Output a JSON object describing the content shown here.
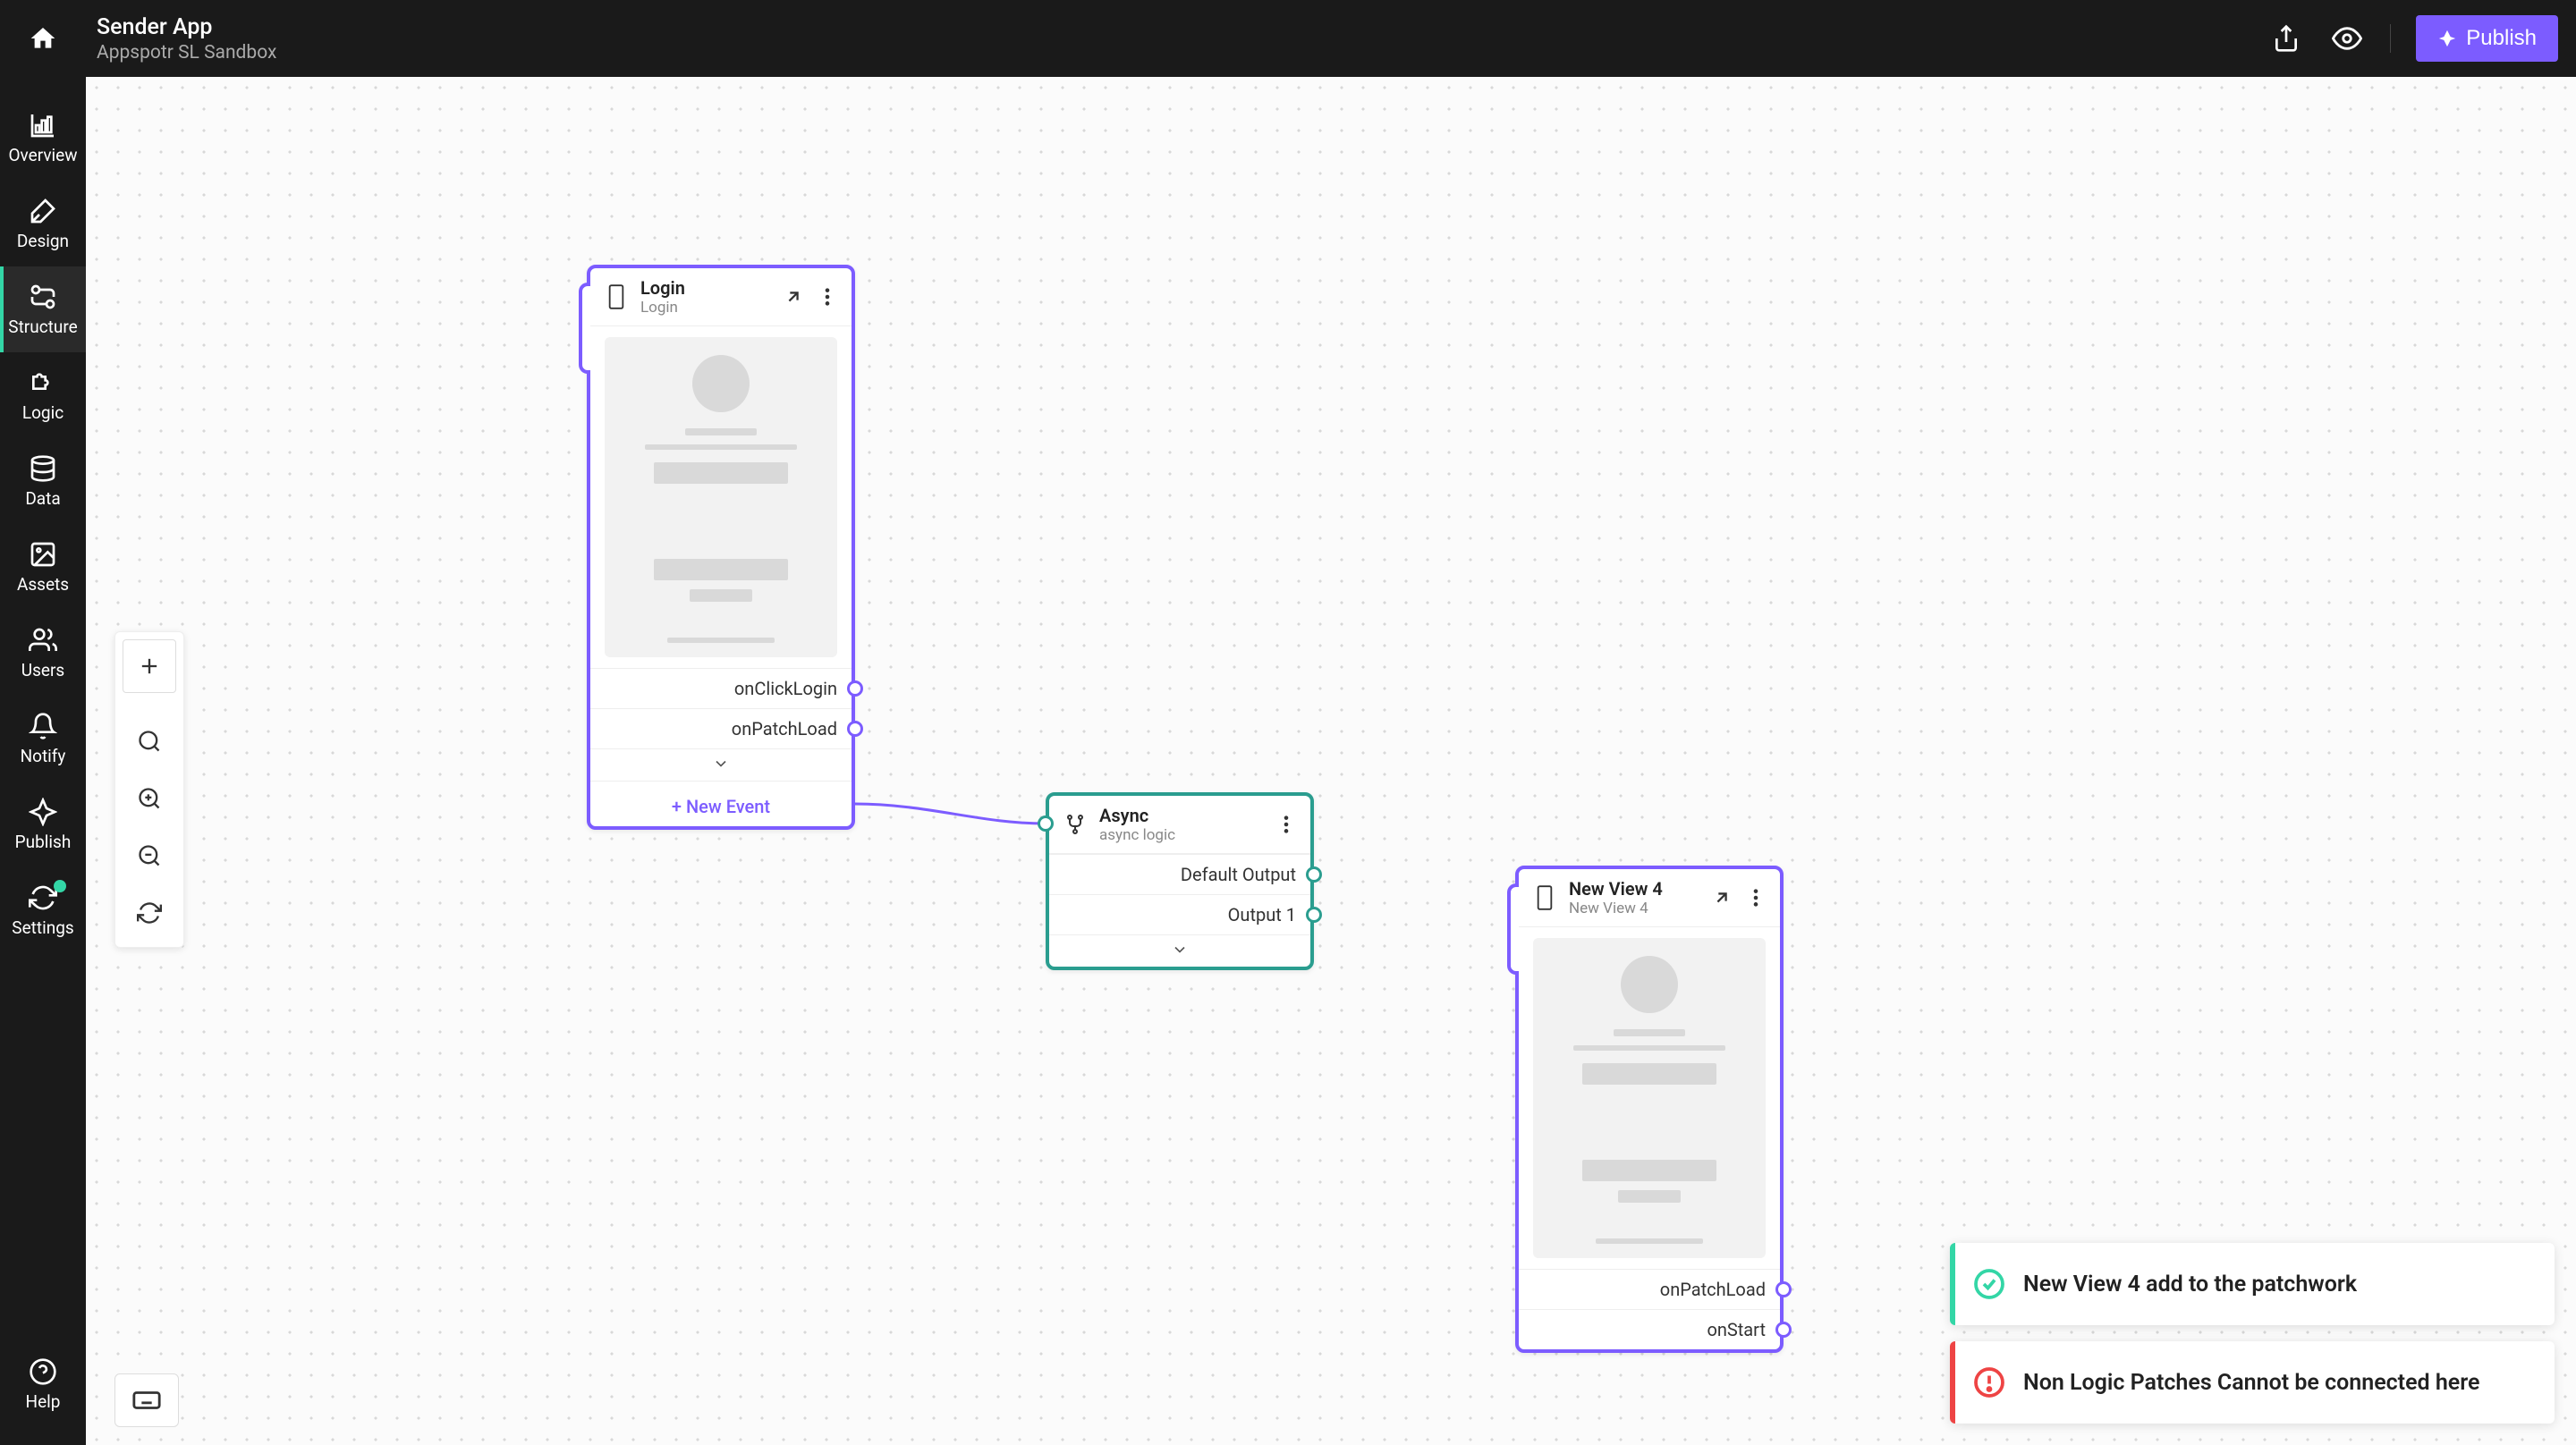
{
  "header": {
    "appName": "Sender App",
    "subtitle": "Appspotr SL Sandbox",
    "publishLabel": "Publish"
  },
  "sidebar": {
    "items": [
      {
        "label": "Overview"
      },
      {
        "label": "Design"
      },
      {
        "label": "Structure"
      },
      {
        "label": "Logic"
      },
      {
        "label": "Data"
      },
      {
        "label": "Assets"
      },
      {
        "label": "Users"
      },
      {
        "label": "Notify"
      },
      {
        "label": "Publish"
      },
      {
        "label": "Settings"
      }
    ],
    "help": "Help"
  },
  "nodes": {
    "login": {
      "title": "Login",
      "subtitle": "Login",
      "events": [
        "onClickLogin",
        "onPatchLoad"
      ],
      "addEvent": "+ New Event"
    },
    "async": {
      "title": "Async",
      "subtitle": "async logic",
      "outputs": [
        "Default Output",
        "Output 1"
      ]
    },
    "newview": {
      "title": "New View 4",
      "subtitle": "New View 4",
      "events": [
        "onPatchLoad",
        "onStart"
      ]
    }
  },
  "toasts": {
    "success": "New View 4 add to the patchwork",
    "error": "Non Logic Patches Cannot be connected here"
  }
}
